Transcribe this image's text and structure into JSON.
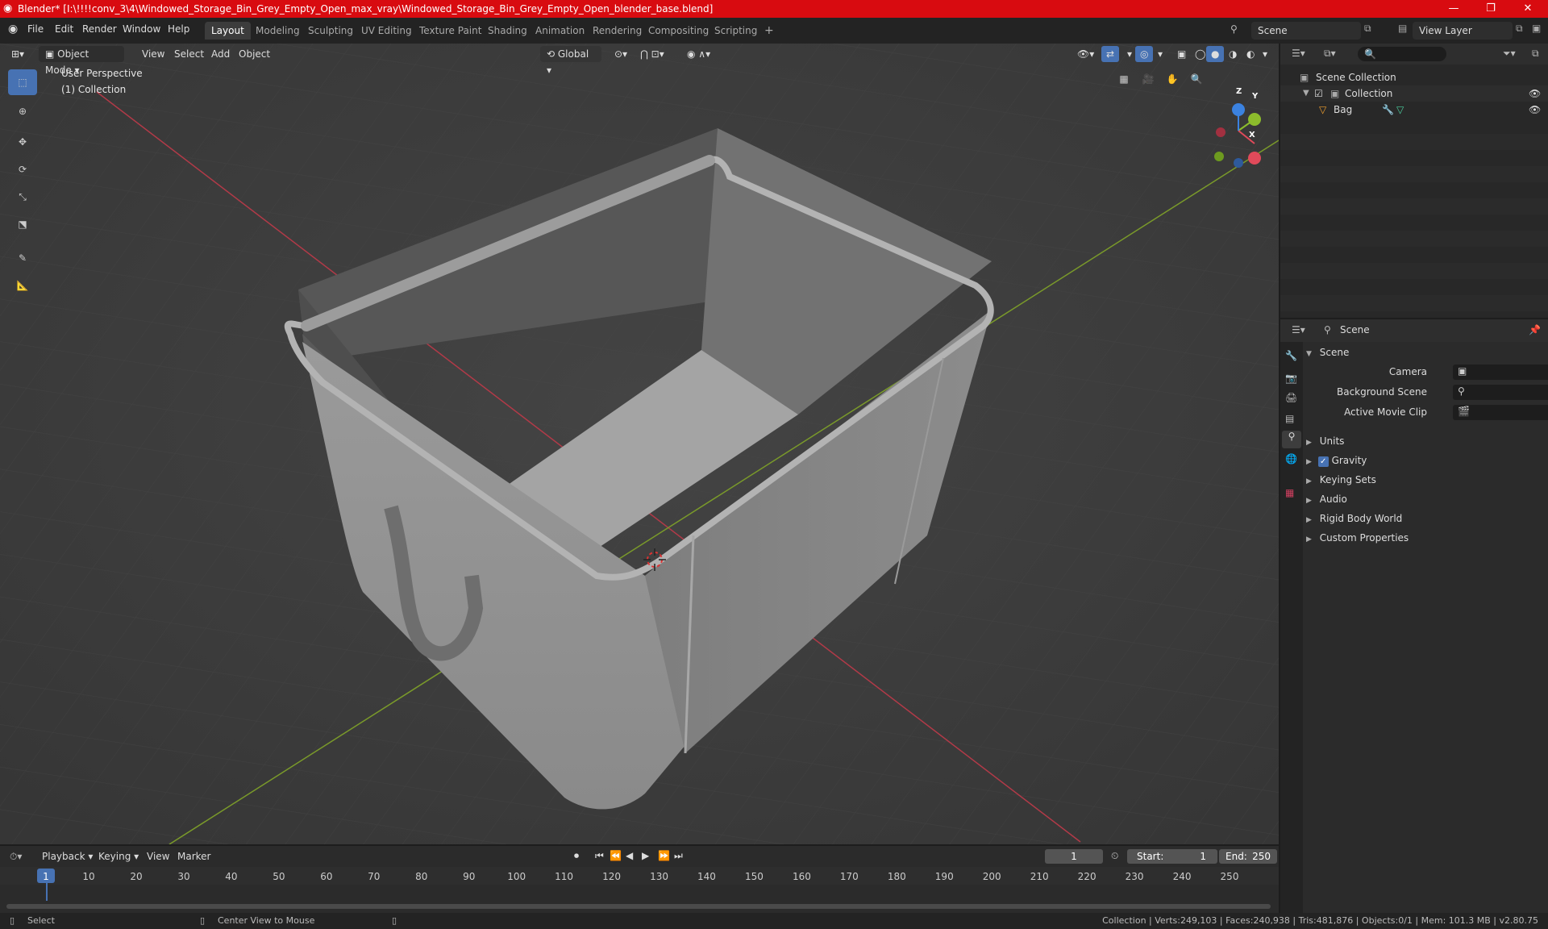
{
  "window": {
    "title": "Blender* [I:\\!!!!conv_3\\4\\Windowed_Storage_Bin_Grey_Empty_Open_max_vray\\Windowed_Storage_Bin_Grey_Empty_Open_blender_base.blend]",
    "controls": [
      "—",
      "❐",
      "✕"
    ]
  },
  "menubar": {
    "menus": [
      "File",
      "Edit",
      "Render",
      "Window",
      "Help"
    ],
    "workspaces": [
      "Layout",
      "Modeling",
      "Sculpting",
      "UV Editing",
      "Texture Paint",
      "Shading",
      "Animation",
      "Rendering",
      "Compositing",
      "Scripting"
    ],
    "active_workspace": "Layout",
    "add_tab": "+",
    "scene": "Scene",
    "view_layer": "View Layer"
  },
  "viewport": {
    "mode": "Object Mode",
    "menus": [
      "View",
      "Select",
      "Add",
      "Object"
    ],
    "transform_orientation": "Global",
    "overlay_text": {
      "perspective": "User Perspective",
      "collection": "(1) Collection"
    },
    "gizmo": {
      "x": "X",
      "y": "Y",
      "z": "Z"
    }
  },
  "outliner": {
    "search_placeholder": "",
    "scene_collection": "Scene Collection",
    "collection": "Collection",
    "object": "Bag"
  },
  "properties": {
    "context": "Scene",
    "panel_title": "Scene",
    "fields": {
      "camera": "Camera",
      "background_scene": "Background Scene",
      "active_movie_clip": "Active Movie Clip"
    },
    "panels": [
      "Units",
      "Gravity",
      "Keying Sets",
      "Audio",
      "Rigid Body World",
      "Custom Properties"
    ],
    "gravity_checked": true
  },
  "timeline": {
    "menus": [
      "Playback",
      "Keying",
      "View",
      "Marker"
    ],
    "current_frame": "1",
    "start_label": "Start:",
    "start": "1",
    "end_label": "End:",
    "end": "250",
    "ticks": [
      "1",
      "10",
      "20",
      "30",
      "40",
      "50",
      "60",
      "70",
      "80",
      "90",
      "100",
      "110",
      "120",
      "130",
      "140",
      "150",
      "160",
      "170",
      "180",
      "190",
      "200",
      "210",
      "220",
      "230",
      "240",
      "250"
    ]
  },
  "statusbar": {
    "select": "Select",
    "center_view": "Center View to Mouse",
    "stats": "Collection | Verts:249,103 | Faces:240,938 | Tris:481,876 | Objects:0/1 | Mem: 101.3 MB | v2.80.75"
  },
  "colors": {
    "title_bar": "#d80b10",
    "active_tool": "#4772b3",
    "x_axis": "#e04a5a",
    "y_axis": "#8cbc2c",
    "z_axis": "#3b82e0",
    "viewport_bg": "#3d3d3d"
  }
}
